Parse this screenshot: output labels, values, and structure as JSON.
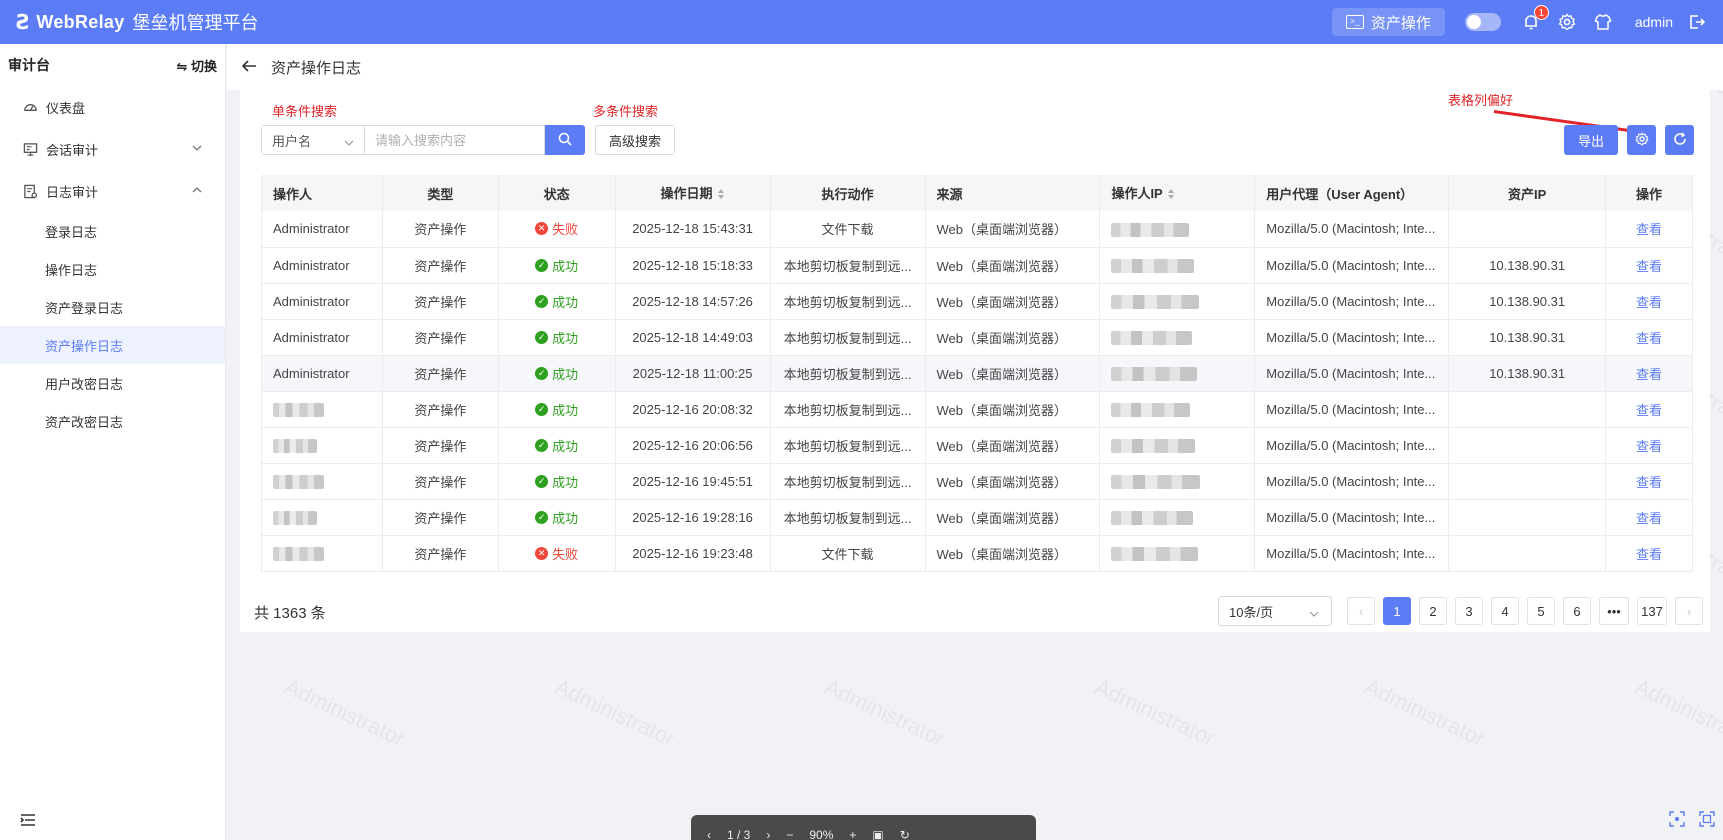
{
  "header": {
    "logo_mark": "Ƨ",
    "brand": "WebRelay",
    "subtitle": "堡垒机管理平台",
    "asset_op_label": "资产操作",
    "notification_count": "1",
    "username": "admin"
  },
  "sidebar": {
    "title": "审计台",
    "switch_label": "⇋ 切换",
    "dashboard": "仪表盘",
    "session_audit": "会话审计",
    "log_audit": "日志审计",
    "sub_items": [
      "登录日志",
      "操作日志",
      "资产登录日志",
      "资产操作日志",
      "用户改密日志",
      "资产改密日志"
    ],
    "active_item": "资产操作日志"
  },
  "page": {
    "title": "资产操作日志"
  },
  "annotations": {
    "single_search": "单条件搜索",
    "multi_search": "多条件搜索",
    "column_pref": "表格列偏好"
  },
  "search": {
    "field_select": "用户名",
    "placeholder": "请输入搜索内容",
    "advanced_label": "高级搜索"
  },
  "toolbar": {
    "export_label": "导出"
  },
  "table": {
    "columns": [
      "操作人",
      "类型",
      "状态",
      "操作日期",
      "执行动作",
      "来源",
      "操作人IP",
      "用户代理（User Agent）",
      "资产IP",
      "操作"
    ],
    "rows": [
      {
        "operator": "Administrator",
        "type": "资产操作",
        "status": "失败",
        "date": "2025-12-18 15:43:31",
        "action": "文件下载",
        "source": "Web（桌面端浏览器）",
        "ua": "Mozilla/5.0 (Macintosh; Inte...",
        "asset_ip": "",
        "op": "查看"
      },
      {
        "operator": "Administrator",
        "type": "资产操作",
        "status": "成功",
        "date": "2025-12-18 15:18:33",
        "action": "本地剪切板复制到远...",
        "source": "Web（桌面端浏览器）",
        "ua": "Mozilla/5.0 (Macintosh; Inte...",
        "asset_ip": "10.138.90.31",
        "op": "查看"
      },
      {
        "operator": "Administrator",
        "type": "资产操作",
        "status": "成功",
        "date": "2025-12-18 14:57:26",
        "action": "本地剪切板复制到远...",
        "source": "Web（桌面端浏览器）",
        "ua": "Mozilla/5.0 (Macintosh; Inte...",
        "asset_ip": "10.138.90.31",
        "op": "查看"
      },
      {
        "operator": "Administrator",
        "type": "资产操作",
        "status": "成功",
        "date": "2025-12-18 14:49:03",
        "action": "本地剪切板复制到远...",
        "source": "Web（桌面端浏览器）",
        "ua": "Mozilla/5.0 (Macintosh; Inte...",
        "asset_ip": "10.138.90.31",
        "op": "查看"
      },
      {
        "operator": "Administrator",
        "type": "资产操作",
        "status": "成功",
        "date": "2025-12-18 11:00:25",
        "action": "本地剪切板复制到远...",
        "source": "Web（桌面端浏览器）",
        "ua": "Mozilla/5.0 (Macintosh; Inte...",
        "asset_ip": "10.138.90.31",
        "op": "查看"
      },
      {
        "operator": "",
        "type": "资产操作",
        "status": "成功",
        "date": "2025-12-16 20:08:32",
        "action": "本地剪切板复制到远...",
        "source": "Web（桌面端浏览器）",
        "ua": "Mozilla/5.0 (Macintosh; Inte...",
        "asset_ip": "",
        "op": "查看"
      },
      {
        "operator": "",
        "type": "资产操作",
        "status": "成功",
        "date": "2025-12-16 20:06:56",
        "action": "本地剪切板复制到远...",
        "source": "Web（桌面端浏览器）",
        "ua": "Mozilla/5.0 (Macintosh; Inte...",
        "asset_ip": "",
        "op": "查看"
      },
      {
        "operator": "",
        "type": "资产操作",
        "status": "成功",
        "date": "2025-12-16 19:45:51",
        "action": "本地剪切板复制到远...",
        "source": "Web（桌面端浏览器）",
        "ua": "Mozilla/5.0 (Macintosh; Inte...",
        "asset_ip": "",
        "op": "查看"
      },
      {
        "operator": "",
        "type": "资产操作",
        "status": "成功",
        "date": "2025-12-16 19:28:16",
        "action": "本地剪切板复制到远...",
        "source": "Web（桌面端浏览器）",
        "ua": "Mozilla/5.0 (Macintosh; Inte...",
        "asset_ip": "",
        "op": "查看"
      },
      {
        "operator": "",
        "type": "资产操作",
        "status": "失败",
        "date": "2025-12-16 19:23:48",
        "action": "文件下载",
        "source": "Web（桌面端浏览器）",
        "ua": "Mozilla/5.0 (Macintosh; Inte...",
        "asset_ip": "",
        "op": "查看"
      }
    ]
  },
  "footer": {
    "total_label": "共 1363 条",
    "page_size": "10条/页",
    "pages": [
      "1",
      "2",
      "3",
      "4",
      "5",
      "6",
      "•••",
      "137"
    ],
    "current_page": "1"
  },
  "pdf_toolbar": {
    "page_indicator": "1 / 3",
    "zoom": "90%"
  },
  "watermark_text": "Administrator",
  "colors": {
    "primary": "#5b7cf5",
    "success": "#2ea121",
    "danger": "#f0463b",
    "annotation": "#e0242a"
  }
}
